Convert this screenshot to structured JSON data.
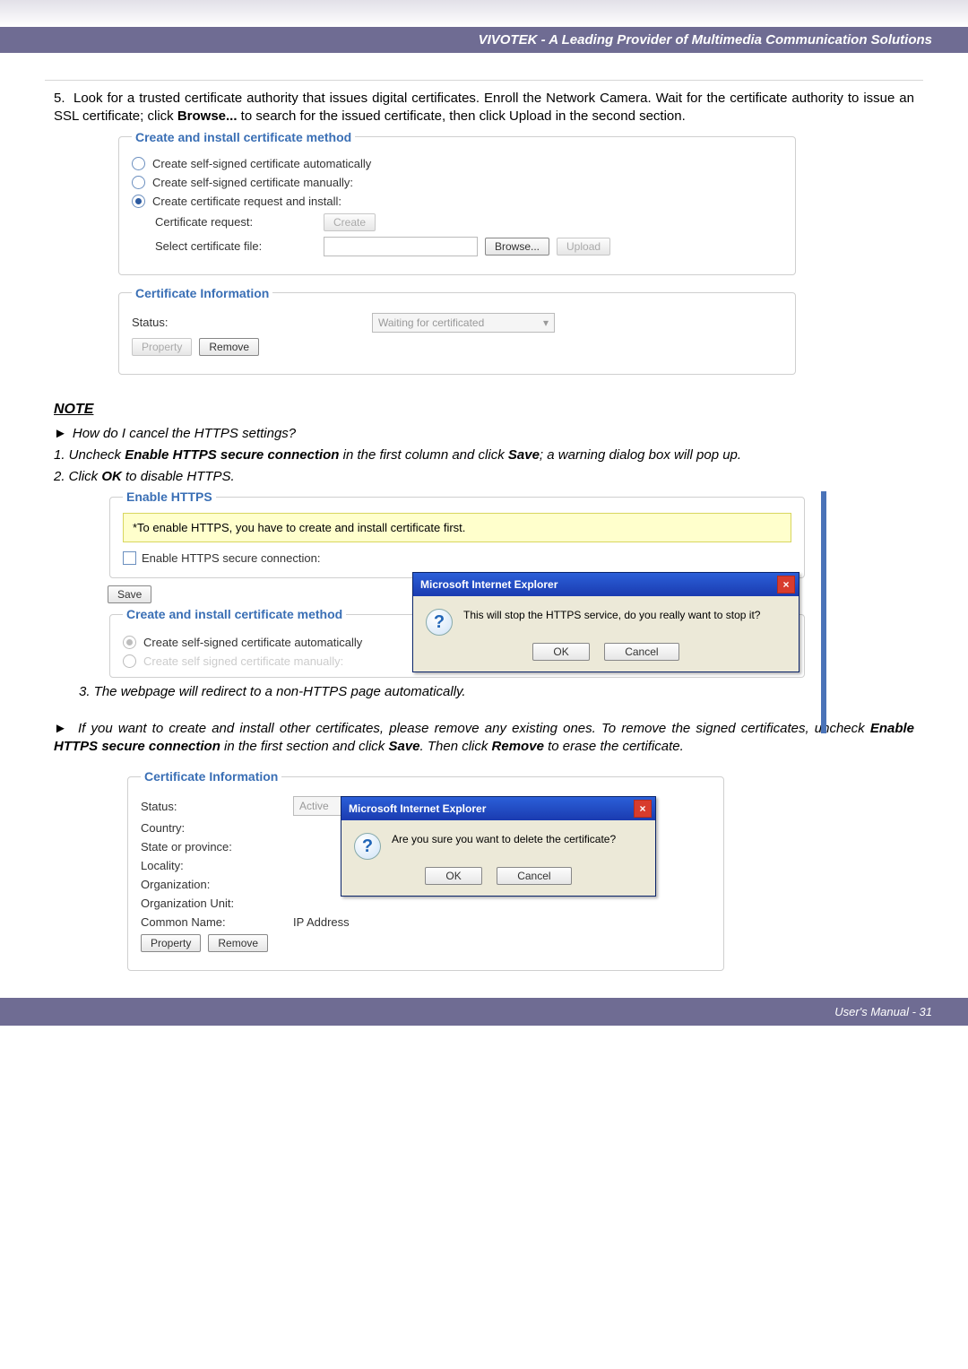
{
  "header": {
    "brand": "VIVOTEK - A Leading Provider of Multimedia Communication Solutions"
  },
  "step5": {
    "num": "5.",
    "text_before": "Look for a trusted certificate authority that issues digital certificates. Enroll the Network Camera. Wait for the certificate authority to issue an SSL certificate; click ",
    "bold": "Browse...",
    "text_after": " to search for the issued certificate, then click Upload in the second section."
  },
  "ss1": {
    "legend": "Create and install certificate method",
    "opt_auto": "Create self-signed certificate automatically",
    "opt_manual": "Create self-signed certificate manually:",
    "opt_request": "Create certificate request and install:",
    "cert_request_lbl": "Certificate request:",
    "create_btn": "Create",
    "select_file_lbl": "Select certificate file:",
    "browse_btn": "Browse...",
    "upload_btn": "Upload"
  },
  "ss1b": {
    "legend": "Certificate Information",
    "status_lbl": "Status:",
    "status_value": "Waiting for certificated",
    "property_btn": "Property",
    "remove_btn": "Remove"
  },
  "note": {
    "title": "NOTE",
    "q1": "How do I cancel the HTTPS settings?",
    "q1_1_pre": "1. Uncheck ",
    "q1_1_b": "Enable HTTPS secure connection",
    "q1_1_mid": " in the first column and click ",
    "q1_1_b2": "Save",
    "q1_1_post": "; a warning dialog box will pop up.",
    "q1_2_pre": "2. Click ",
    "q1_2_b": "OK",
    "q1_2_post": " to disable HTTPS.",
    "q1_3": "3. The webpage will redirect to a non-HTTPS page automatically.",
    "q2_pre": "If you want to create and install other certificates, please remove any existing ones. To remove the signed certificates, uncheck ",
    "q2_b1": "Enable HTTPS secure connection",
    "q2_mid": " in the first section and click ",
    "q2_b2": "Save",
    "q2_mid2": ". Then click ",
    "q2_b3": "Remove",
    "q2_post": " to erase the certificate."
  },
  "enable": {
    "legend": "Enable HTTPS",
    "hint": "*To enable HTTPS, you have to create and install certificate first.",
    "check_lbl": "Enable HTTPS secure connection:",
    "save_btn": "Save",
    "legend2": "Create and install certificate method",
    "opt_auto": "Create self-signed certificate automatically",
    "opt_manual_cut": "Create self signed certificate manually:"
  },
  "dlg1": {
    "title": "Microsoft Internet Explorer",
    "msg": "This will stop the HTTPS service, do you really want to stop it?",
    "ok": "OK",
    "cancel": "Cancel"
  },
  "dlg2": {
    "title": "Microsoft Internet Explorer",
    "msg": "Are you sure you want to delete the certificate?",
    "ok": "OK",
    "cancel": "Cancel"
  },
  "certinfo": {
    "legend": "Certificate Information",
    "status_lbl": "Status:",
    "status_val": "Active",
    "country_lbl": "Country:",
    "state_lbl": "State or province:",
    "locality_lbl": "Locality:",
    "org_lbl": "Organization:",
    "orgunit_lbl": "Organization Unit:",
    "cn_lbl": "Common Name:",
    "cn_val": "IP Address",
    "property_btn": "Property",
    "remove_btn": "Remove"
  },
  "footer": {
    "text": "User's Manual - 31"
  }
}
